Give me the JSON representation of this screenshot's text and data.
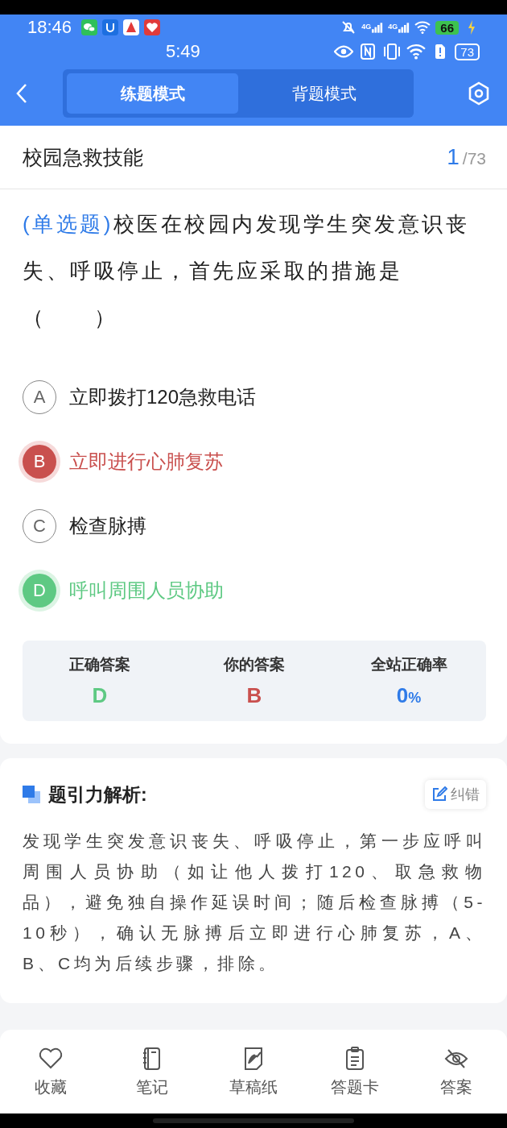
{
  "status_bar": {
    "time": "18:46",
    "time2": "5:49",
    "network": [
      "4G",
      "4G"
    ],
    "battery": "66",
    "battery2": "73"
  },
  "header": {
    "tabs": [
      {
        "label": "练题模式",
        "selected": true
      },
      {
        "label": "背题模式",
        "selected": false
      }
    ]
  },
  "question_bar": {
    "title": "校园急救技能",
    "current": "1",
    "total": "/73"
  },
  "question": {
    "type_tag": "(单选题)",
    "text": "校医在校园内发现学生突发意识丧失、呼吸停止，首先应采取的措施是（　　）",
    "options": [
      {
        "letter": "A",
        "text": "立即拨打120急救电话",
        "kind": "normal"
      },
      {
        "letter": "B",
        "text": "立即进行心肺复苏",
        "kind": "wrong"
      },
      {
        "letter": "C",
        "text": "检查脉搏",
        "kind": "normal"
      },
      {
        "letter": "D",
        "text": "呼叫周围人员协助",
        "kind": "correct"
      }
    ]
  },
  "stats": [
    {
      "label": "正确答案",
      "value": "D",
      "color": "#5ec983"
    },
    {
      "label": "你的答案",
      "value": "B",
      "color": "#c9504e"
    },
    {
      "label": "全站正确率",
      "value": "0",
      "unit": "%",
      "color": "#2f7be8"
    }
  ],
  "analysis": {
    "title": "题引力解析:",
    "report_button": "纠错",
    "text": "发现学生突发意识丧失、呼吸停止，第一步应呼叫周围人员协助（如让他人拨打120、取急救物品），避免独自操作延误时间；随后检查脉搏（5-10秒），确认无脉搏后立即进行心肺复苏，A、B、C均为后续步骤，排除。"
  },
  "bottom_bar": [
    {
      "label": "收藏"
    },
    {
      "label": "笔记"
    },
    {
      "label": "草稿纸"
    },
    {
      "label": "答题卡"
    },
    {
      "label": "答案"
    }
  ]
}
